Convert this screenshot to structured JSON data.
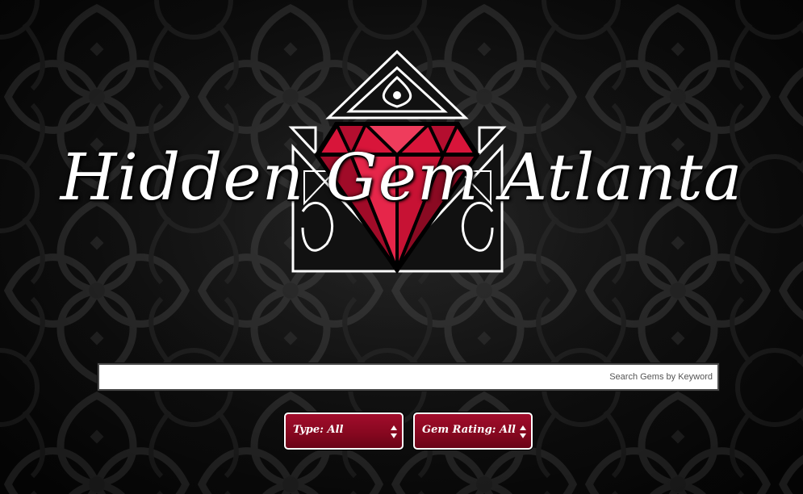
{
  "site": {
    "title": "Hidden Gem Atlanta"
  },
  "search": {
    "placeholder": "Search Gems by Keyword",
    "value": ""
  },
  "filters": {
    "type_label": "Type: All",
    "rating_label": "Gem Rating: All"
  },
  "icons": {
    "logo": "ruby-diamond-ornate-logo",
    "select_arrows": "up-down-chevron-icon"
  },
  "colors": {
    "ruby": "#d8153a",
    "ruby_dark": "#8a0a22",
    "select_bg": "#8e0a25",
    "background": "#151515",
    "ornament": "#3a3a3a"
  }
}
